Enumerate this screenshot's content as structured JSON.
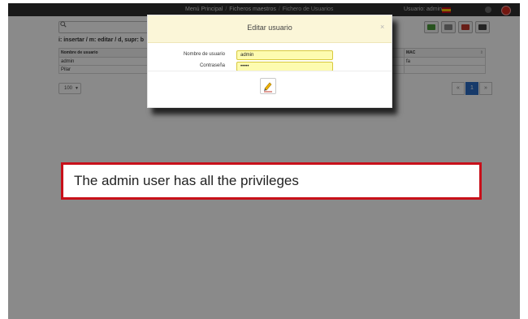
{
  "nav": {
    "menu_principal": "Menú Principal",
    "sep": "/",
    "ficheros_maestros": "Ficheros maestros",
    "fichero_usuarios": "Fichero de Usuarios",
    "user_label": "Usuario: admin"
  },
  "toolbar": {
    "search_placeholder": "",
    "hint": "i: insertar / m: editar / d, supr: b"
  },
  "table": {
    "headers": [
      "Nombre de usuario",
      "MAC"
    ],
    "rows": [
      [
        "admin",
        "fa"
      ],
      [
        "Pilar",
        ""
      ]
    ]
  },
  "pagination": {
    "page_size": "100",
    "prev": "«",
    "current": "1",
    "next": "»"
  },
  "modal": {
    "title": "Editar usuario",
    "close": "×",
    "username_label": "Nombre de usuario",
    "username_value": "admin",
    "password_label": "Contraseña",
    "password_value": "•••••"
  },
  "annotation": {
    "text": "The admin user has all the privileges"
  },
  "colors": {
    "accent": "#2b6cc4",
    "modal_header": "#fbf6d8",
    "input_highlight": "#fdfbb0",
    "callout_border": "#c8101a"
  },
  "icons": [
    "search-icon",
    "export-icon",
    "print-icon",
    "pdf-icon",
    "save-icon",
    "pencil-icon",
    "close-icon",
    "power-icon",
    "flag-icon"
  ]
}
